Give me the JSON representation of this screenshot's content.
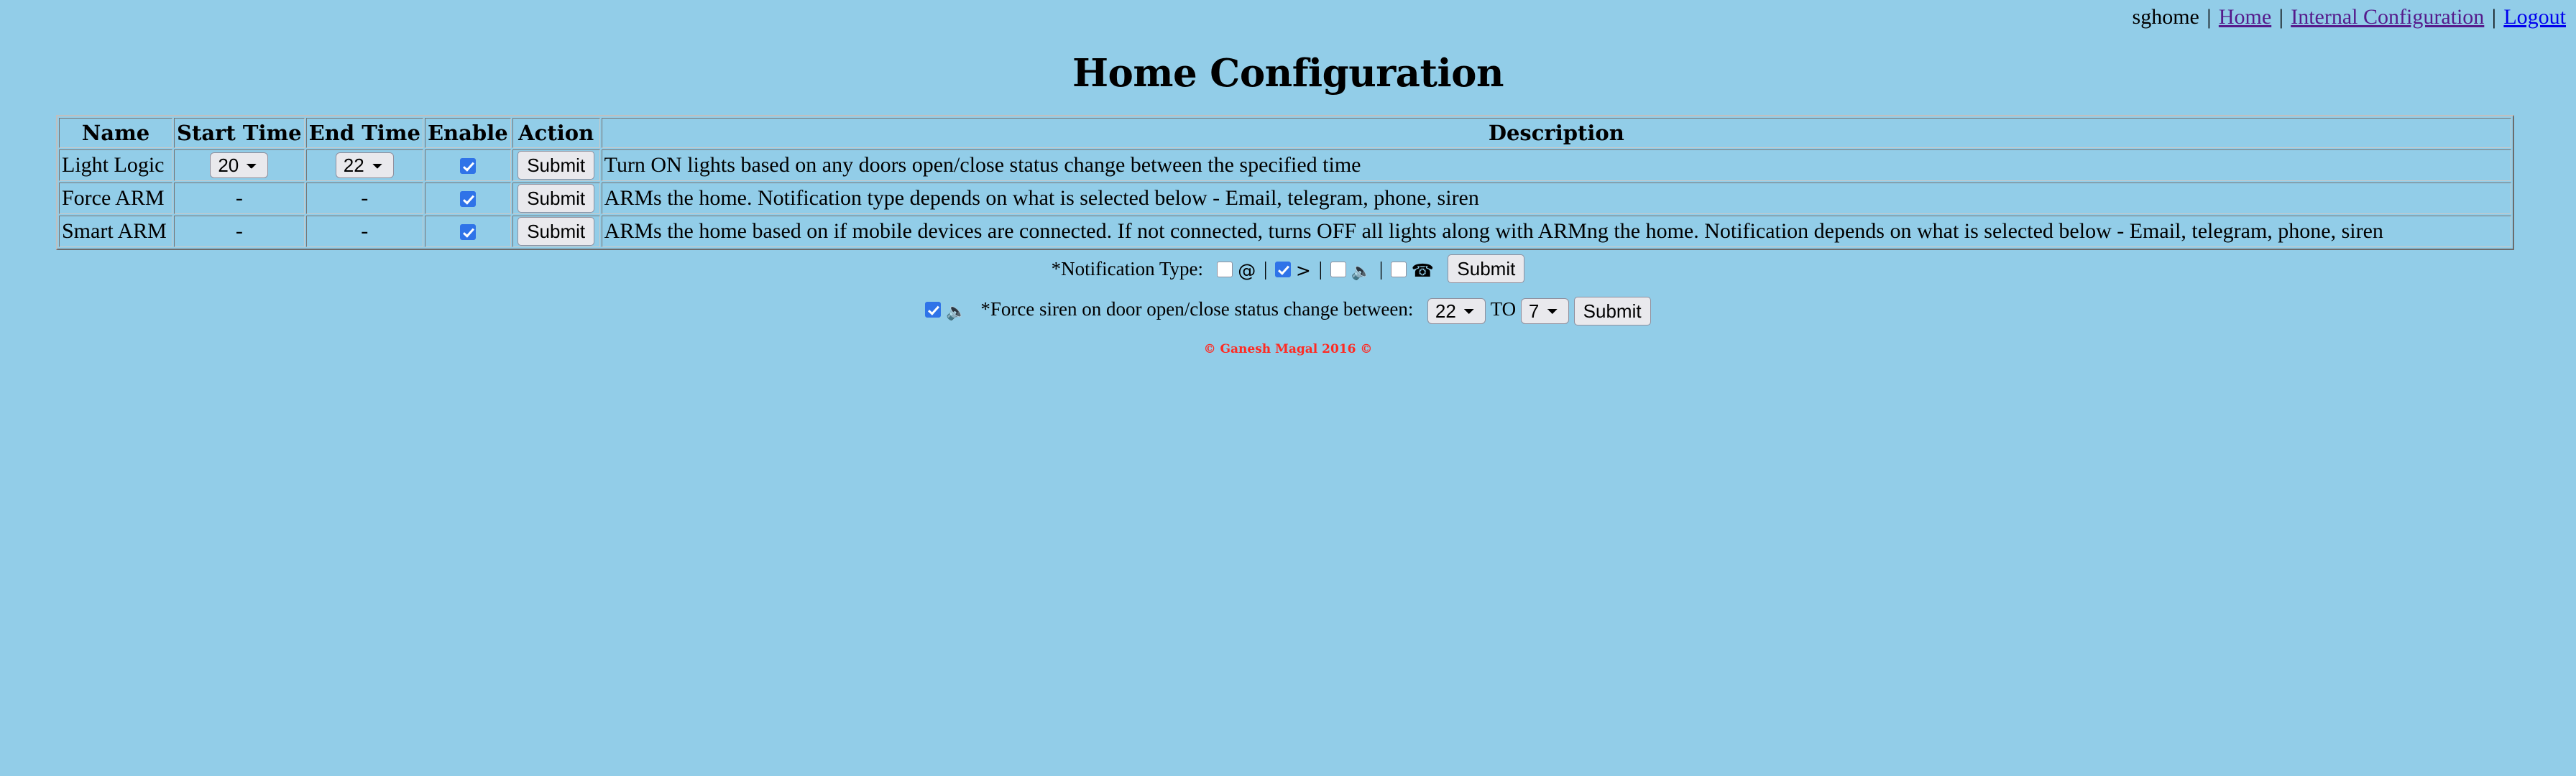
{
  "topbar": {
    "username": "sghome",
    "separator": "|",
    "links": [
      {
        "label": "Home",
        "state": "visited"
      },
      {
        "label": "Internal Configuration",
        "state": "visited"
      },
      {
        "label": "Logout",
        "state": "unvisited"
      }
    ]
  },
  "page": {
    "title": "Home Configuration"
  },
  "table": {
    "headers": [
      "Name",
      "Start Time",
      "End Time",
      "Enable",
      "Action",
      "Description"
    ],
    "rows": [
      {
        "name": "Light Logic",
        "start_time": "20",
        "end_time": "22",
        "has_selects": true,
        "enabled": true,
        "action_label": "Submit",
        "description": "Turn ON lights based on any doors open/close status change between the specified time"
      },
      {
        "name": "Force ARM",
        "start_time": "-",
        "end_time": "-",
        "has_selects": false,
        "enabled": true,
        "action_label": "Submit",
        "description": "ARMs the home. Notification type depends on what is selected below - Email, telegram, phone, siren"
      },
      {
        "name": "Smart ARM",
        "start_time": "-",
        "end_time": "-",
        "has_selects": false,
        "enabled": true,
        "action_label": "Submit",
        "description": "ARMs the home based on if mobile devices are connected. If not connected, turns OFF all lights along with ARMng the home. Notification depends on what is selected below - Email, telegram, phone, siren"
      }
    ]
  },
  "notification": {
    "label": "*Notification Type:",
    "separator": "|",
    "options": [
      {
        "icon": "at-sign-icon",
        "glyph": "@",
        "checked": false
      },
      {
        "icon": "telegram-arrow-icon",
        "glyph": ">",
        "checked": true
      },
      {
        "icon": "speaker-icon",
        "glyph": "🔈",
        "checked": false
      },
      {
        "icon": "telephone-icon",
        "glyph": "☎",
        "checked": false
      }
    ],
    "submit_label": "Submit"
  },
  "siren": {
    "checked": true,
    "icon": "speaker-icon",
    "icon_glyph": "🔈",
    "label": "*Force siren on door open/close status change between:",
    "start_time": "22",
    "to_label": "TO",
    "end_time": "7",
    "submit_label": "Submit"
  },
  "footer": {
    "copyright": "© Ganesh Magal 2016 ©",
    "color": "#FF2A22"
  },
  "colors": {
    "background": "#92CDE8",
    "accent_checkbox": "#2f73e8",
    "link_visited": "#551A8B",
    "link_unvisited": "#0000EE",
    "footer_text": "#FF2A22"
  }
}
